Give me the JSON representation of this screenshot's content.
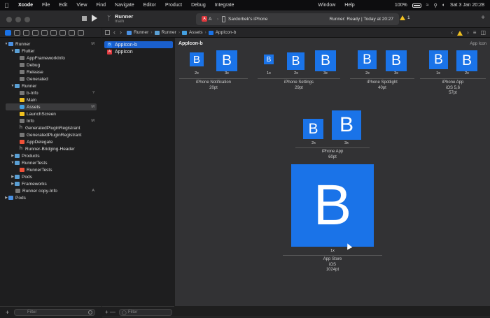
{
  "menubar": {
    "app_name": "Xcode",
    "menus": [
      "File",
      "Edit",
      "View",
      "Find",
      "Navigate",
      "Editor",
      "Product",
      "Debug",
      "Integrate",
      "Window",
      "Help"
    ],
    "battery_percent": "100%",
    "datetime": "Sat 3 Jan  20:28"
  },
  "toolbar": {
    "project_name": "Runner",
    "branch": "main",
    "scheme": "A",
    "scheme_sep": "›",
    "device": "Sardorbek's iPhone",
    "status": "Runner: Ready | Today at 20:27",
    "warning_count": "1"
  },
  "navigator": {
    "rows": [
      {
        "label": "Runner",
        "badge": "M"
      },
      {
        "label": "Flutter",
        "badge": ""
      },
      {
        "label": "AppFrameworkInfo",
        "badge": ""
      },
      {
        "label": "Debug",
        "badge": ""
      },
      {
        "label": "Release",
        "badge": ""
      },
      {
        "label": "Generated",
        "badge": ""
      },
      {
        "label": "Runner",
        "badge": ""
      },
      {
        "label": "b-Info",
        "badge": "?"
      },
      {
        "label": "Main",
        "badge": ""
      },
      {
        "label": "Assets",
        "badge": "M"
      },
      {
        "label": "LaunchScreen",
        "badge": ""
      },
      {
        "label": "Info",
        "badge": "M"
      },
      {
        "label": "GeneratedPluginRegistrant",
        "badge": ""
      },
      {
        "label": "GeneratedPluginRegistrant",
        "badge": ""
      },
      {
        "label": "AppDelegate",
        "badge": ""
      },
      {
        "label": "Runner-Bridging-Header",
        "badge": ""
      },
      {
        "label": "Products",
        "badge": ""
      },
      {
        "label": "RunnerTests",
        "badge": ""
      },
      {
        "label": "RunnerTests",
        "badge": ""
      },
      {
        "label": "Pods",
        "badge": ""
      },
      {
        "label": "Frameworks",
        "badge": ""
      },
      {
        "label": "Runner copy-Info",
        "badge": "A"
      },
      {
        "label": "Pods",
        "badge": ""
      }
    ],
    "filter_placeholder": "Filter"
  },
  "asset_list": {
    "items": [
      {
        "label": "AppIcon-b",
        "icon": "B"
      },
      {
        "label": "AppIcon",
        "icon": "A"
      }
    ],
    "filter_placeholder": "Filter"
  },
  "jumpbar": {
    "path": [
      "Runner",
      "Runner",
      "Assets",
      "AppIcon-b"
    ]
  },
  "editor": {
    "title": "AppIcon-b",
    "kind": "App Icon",
    "icon_letter": "B",
    "groups": [
      {
        "name": "iPhone Notification",
        "size": "20pt",
        "scales": [
          "2x",
          "3x"
        ]
      },
      {
        "name": "iPhone Settings",
        "size": "29pt",
        "scales": [
          "1x",
          "2x",
          "3x"
        ]
      },
      {
        "name": "iPhone Spotlight",
        "size": "40pt",
        "scales": [
          "2x",
          "3x"
        ]
      },
      {
        "name": "iPhone App",
        "line2": "iOS 5,6",
        "size": "57pt",
        "scales": [
          "1x",
          "2x"
        ]
      },
      {
        "name": "iPhone App",
        "size": "60pt",
        "scales": [
          "2x",
          "3x"
        ]
      },
      {
        "name": "App Store",
        "line2": "iOS",
        "size": "1024pt",
        "scales": [
          "1x"
        ]
      }
    ]
  },
  "colors": {
    "accent": "#1a73e8",
    "editor_bg": "#323234",
    "sidebar_bg": "#1e1e1f"
  }
}
